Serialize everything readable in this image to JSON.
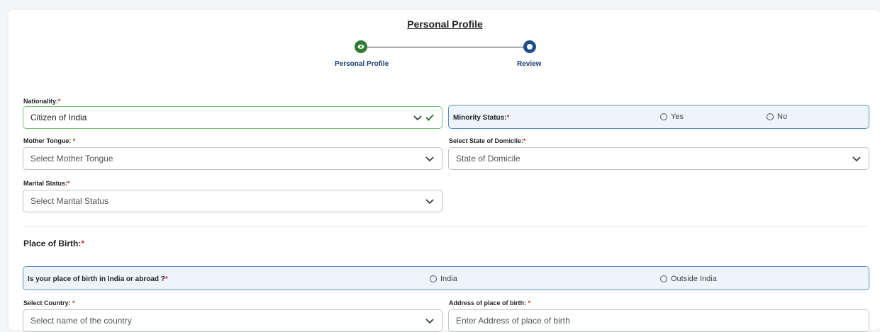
{
  "header": {
    "title": "Personal Profile"
  },
  "stepper": {
    "steps": [
      {
        "label": "Personal Profile",
        "state": "active",
        "icon": "eye-icon",
        "color": "#2e7d32"
      },
      {
        "label": "Review",
        "state": "pending",
        "icon": "ring-icon",
        "color": "#1a4e8f"
      }
    ]
  },
  "form": {
    "nationality": {
      "label": "Nationality:",
      "required": "*",
      "value": "Citizen of India"
    },
    "minority": {
      "label": "Minority Status:",
      "required": "*",
      "options": [
        "Yes",
        "No"
      ]
    },
    "mother_tongue": {
      "label": "Mother Tongue: ",
      "required": "*",
      "placeholder": "Select Mother Tongue"
    },
    "domicile": {
      "label": "Select State of Domicile:",
      "required": "*",
      "placeholder": "State of Domicile"
    },
    "marital": {
      "label": "Marital Status:",
      "required": "*",
      "placeholder": "Select Marital Status"
    },
    "birth_section": {
      "title": "Place of Birth:",
      "required": "*"
    },
    "birth_place": {
      "question": "Is your place of birth in India or abroad ?",
      "required": "*",
      "options": [
        "India",
        "Outside India"
      ]
    },
    "country": {
      "label": "Select Country: ",
      "required": "*",
      "placeholder": "Select name of the country"
    },
    "birth_address": {
      "label": "Address of place of birth: ",
      "required": "*",
      "placeholder": "Enter Address of place of birth"
    }
  },
  "colors": {
    "accent": "#1a4e8f",
    "success": "#2e7d32",
    "required": "#d32f2f",
    "radio_bg": "#eef4fb"
  }
}
